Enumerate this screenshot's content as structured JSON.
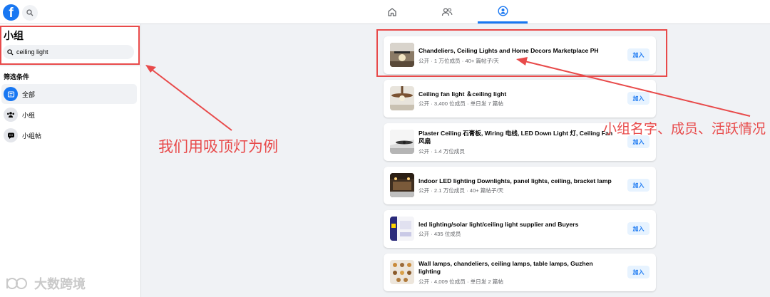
{
  "nav": {
    "logo_letter": "f",
    "tabs": [
      "home",
      "friends",
      "groups"
    ],
    "active_tab": "groups"
  },
  "sidebar": {
    "title": "小组",
    "search_value": "ceiling light",
    "filter_heading": "筛选条件",
    "items": [
      {
        "label": "全部",
        "icon": "feed-icon",
        "active": true
      },
      {
        "label": "小组",
        "icon": "people-icon",
        "active": false
      },
      {
        "label": "小组帖",
        "icon": "post-icon",
        "active": false
      }
    ]
  },
  "results": [
    {
      "title": "Chandeliers, Ceiling Lights and Home Decors Marketplace PH",
      "meta": "公开 · 1 万位成员 · 40+ 篇帖子/天",
      "join": "加入"
    },
    {
      "title": "Ceiling fan light ＆ceiling light",
      "meta": "公开 · 3,400 位成员 · 单日发 7 篇帖",
      "join": "加入"
    },
    {
      "title": "Plaster Ceiling 石膏板, Wiring 电线, LED Down Light 灯, Ceiling Fan 风扇",
      "meta": "公开 · 1.4 万位成员",
      "join": "加入"
    },
    {
      "title": "Indoor LED lighting Downlights, panel lights, ceiling, bracket lamp",
      "meta": "公开 · 2.1 万位成员 · 40+ 篇帖子/天",
      "join": "加入"
    },
    {
      "title": "led lighting/solar light/ceiling light supplier and Buyers",
      "meta": "公开 · 435 位成员",
      "join": "加入"
    },
    {
      "title": "Wall lamps, chandeliers, ceiling lamps, table lamps, Guzhen lighting",
      "meta": "公开 · 4,009 位成员 · 单日发 2 篇帖",
      "join": "加入"
    }
  ],
  "annotations": {
    "left": "我们用吸顶灯为例",
    "right": "小组名字、成员、活跃情况",
    "color": "#e84a4a"
  },
  "watermark": "大数跨境"
}
